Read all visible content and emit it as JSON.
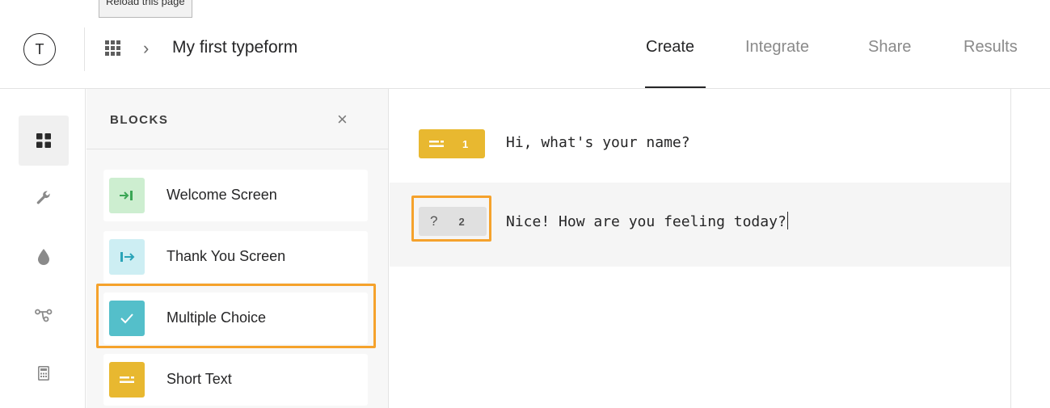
{
  "tooltip": {
    "text": "Reload this page"
  },
  "header": {
    "logo_letter": "T",
    "breadcrumb_chevron": "›",
    "form_title": "My first typeform",
    "nav": [
      {
        "label": "Create",
        "active": true
      },
      {
        "label": "Integrate",
        "active": false
      },
      {
        "label": "Share",
        "active": false
      },
      {
        "label": "Results",
        "active": false
      }
    ]
  },
  "rail": {
    "items": [
      {
        "icon": "blocks-grid-icon",
        "active": true
      },
      {
        "icon": "wrench-icon",
        "active": false
      },
      {
        "icon": "drop-icon",
        "active": false
      },
      {
        "icon": "logic-flow-icon",
        "active": false
      },
      {
        "icon": "calculator-icon",
        "active": false
      }
    ]
  },
  "blocks": {
    "title": "BLOCKS",
    "close_glyph": "×",
    "items": [
      {
        "label": "Welcome Screen",
        "icon": "welcome-arrow-icon",
        "color": "#cdeed0"
      },
      {
        "label": "Thank You Screen",
        "icon": "exit-arrow-icon",
        "color": "#cdeef3"
      },
      {
        "label": "Multiple Choice",
        "icon": "checkmark-icon",
        "color": "#54bfca"
      },
      {
        "label": "Short Text",
        "icon": "short-text-icon",
        "color": "#e8b830"
      }
    ]
  },
  "questions": [
    {
      "number": "1",
      "badge_glyph": "==",
      "text": "Hi, what's your name?",
      "color": "#e8b830"
    },
    {
      "number": "2",
      "badge_glyph": "?",
      "text": "Nice! How are you feeling today?",
      "color": "#e0e0e0"
    }
  ],
  "colors": {
    "highlight": "#f5a22c",
    "accent_yellow": "#e8b830",
    "accent_teal": "#54bfca"
  }
}
